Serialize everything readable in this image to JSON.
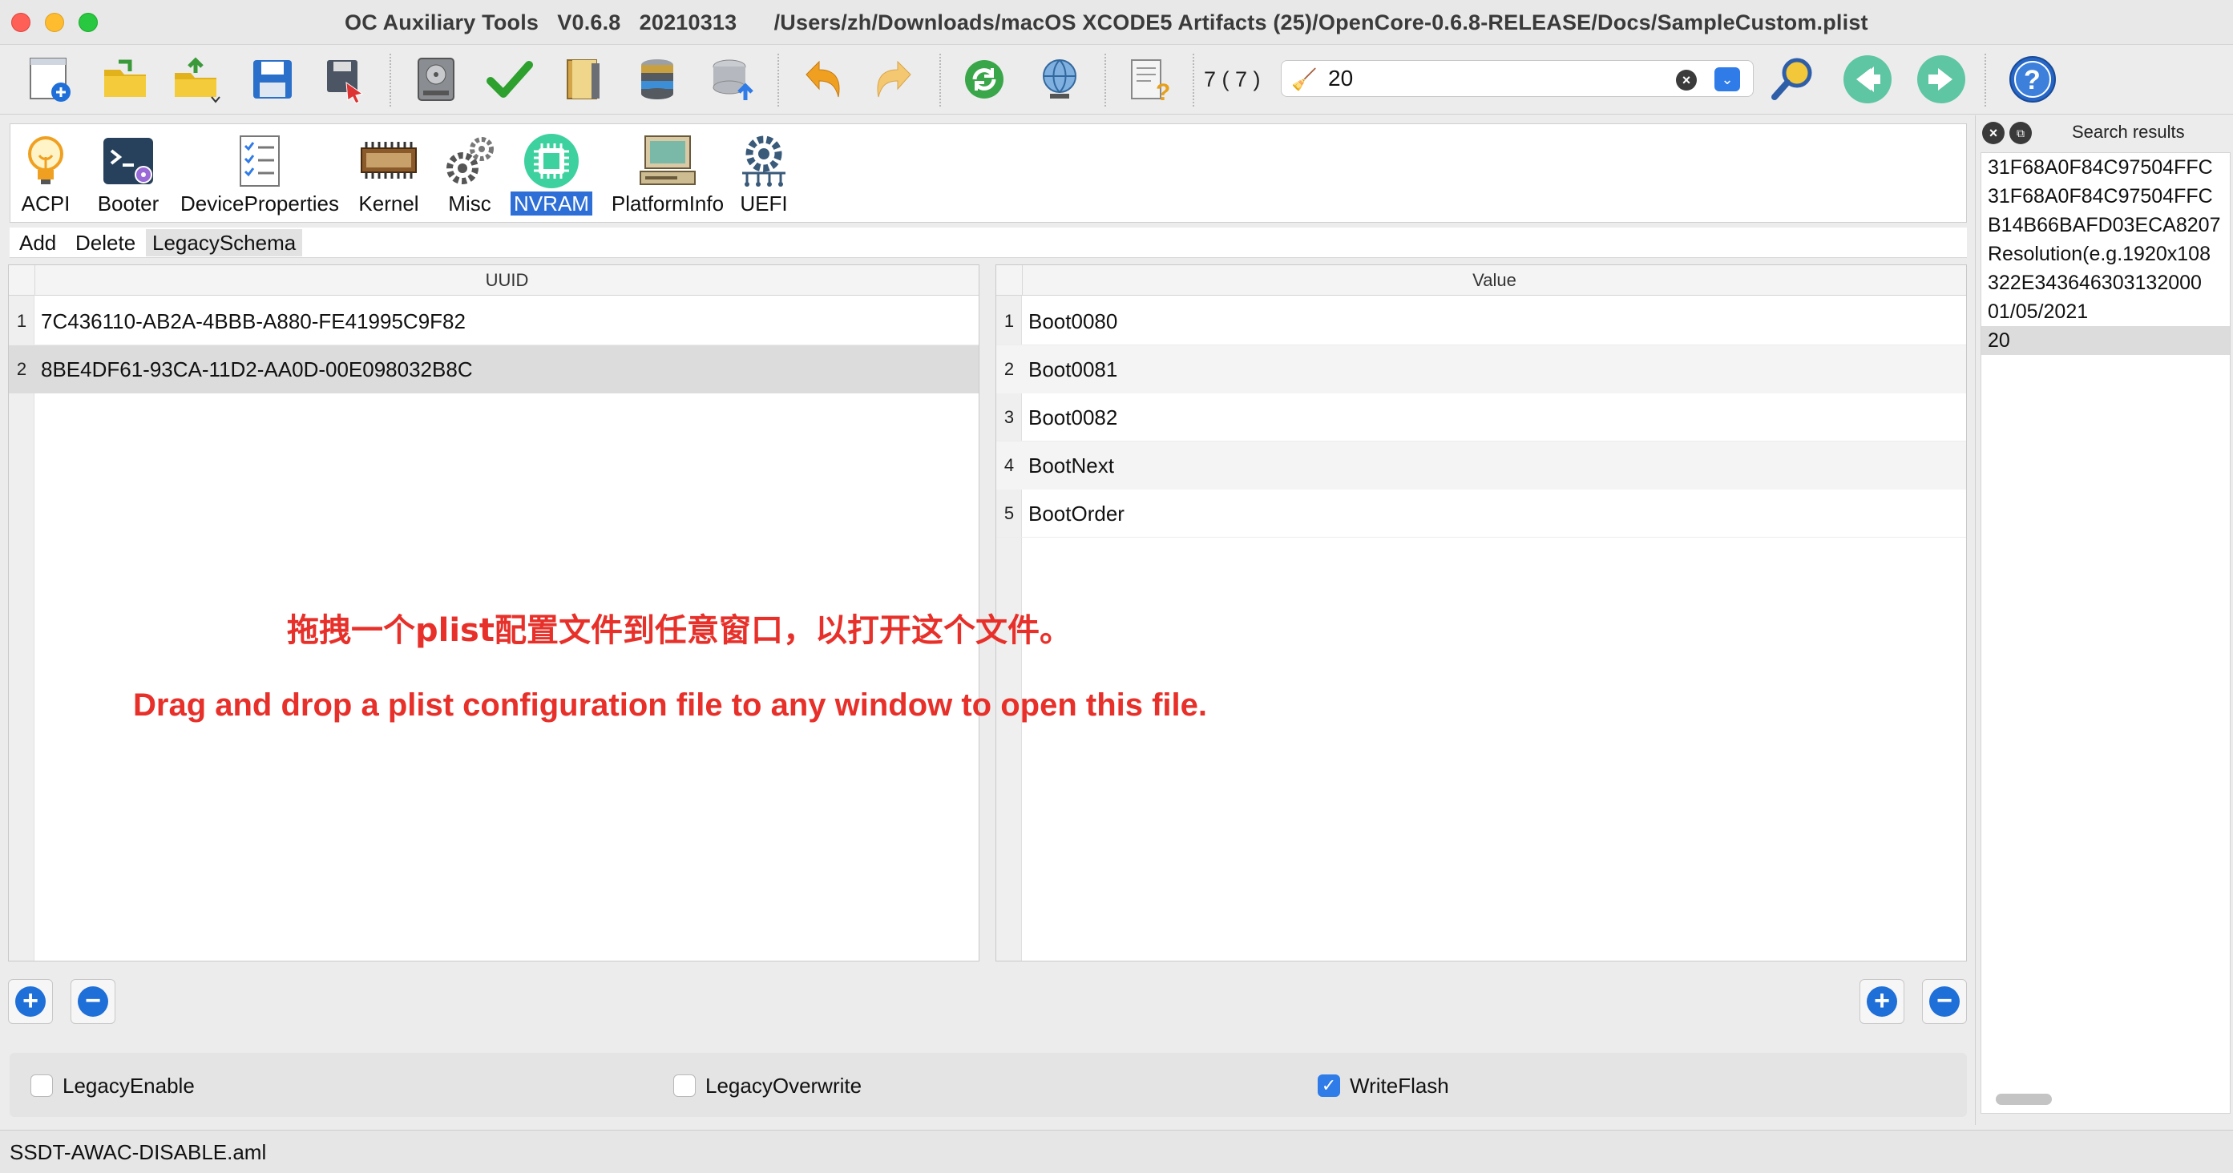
{
  "window": {
    "app_name": "OC Auxiliary Tools",
    "version": "V0.6.8",
    "build": "20210313",
    "file_path": "/Users/zh/Downloads/macOS XCODE5 Artifacts (25)/OpenCore-0.6.8-RELEASE/Docs/SampleCustom.plist"
  },
  "toolbar": {
    "buttons": [
      {
        "name": "new-file",
        "icon": "new-document-icon"
      },
      {
        "name": "open-folder",
        "icon": "folder-icon"
      },
      {
        "name": "open-recent",
        "icon": "folder-arrow-icon"
      },
      {
        "name": "save",
        "icon": "floppy-disk-icon"
      },
      {
        "name": "save-as",
        "icon": "save-as-icon"
      },
      {
        "name": "mount-efi",
        "icon": "hard-disk-icon"
      },
      {
        "name": "verify",
        "icon": "checkmark-icon"
      },
      {
        "name": "open-database",
        "icon": "book-icon"
      },
      {
        "name": "database",
        "icon": "database-icon"
      },
      {
        "name": "upgrade",
        "icon": "database-upload-icon"
      },
      {
        "name": "undo",
        "icon": "undo-arrow-icon"
      },
      {
        "name": "redo",
        "icon": "redo-arrow-icon"
      },
      {
        "name": "refresh",
        "icon": "refresh-icon"
      },
      {
        "name": "network",
        "icon": "globe-icon"
      },
      {
        "name": "help-doc",
        "icon": "document-question-icon"
      }
    ],
    "match_count": "7 ( 7 )",
    "search_value": "20",
    "help_icon": "help-icon"
  },
  "categories": [
    {
      "label": "ACPI",
      "icon": "lightbulb-icon"
    },
    {
      "label": "Booter",
      "icon": "terminal-gear-icon"
    },
    {
      "label": "DeviceProperties",
      "icon": "checklist-icon"
    },
    {
      "label": "Kernel",
      "icon": "chip-icon"
    },
    {
      "label": "Misc",
      "icon": "gears-icon"
    },
    {
      "label": "NVRAM",
      "icon": "nvram-chip-icon"
    },
    {
      "label": "PlatformInfo",
      "icon": "computer-icon"
    },
    {
      "label": "UEFI",
      "icon": "uefi-gear-icon"
    }
  ],
  "active_category": "NVRAM",
  "subtabs": [
    "Add",
    "Delete",
    "LegacySchema"
  ],
  "active_subtab": "LegacySchema",
  "left_table": {
    "header": "UUID",
    "rows": [
      {
        "num": "1",
        "value": "7C436110-AB2A-4BBB-A880-FE41995C9F82"
      },
      {
        "num": "2",
        "value": "8BE4DF61-93CA-11D2-AA0D-00E098032B8C"
      }
    ]
  },
  "right_table": {
    "header": "Value",
    "rows": [
      {
        "num": "1",
        "value": "Boot0080"
      },
      {
        "num": "2",
        "value": "Boot0081"
      },
      {
        "num": "3",
        "value": "Boot0082"
      },
      {
        "num": "4",
        "value": "BootNext"
      },
      {
        "num": "5",
        "value": "BootOrder"
      }
    ]
  },
  "overlay": {
    "zh": "拖拽一个plist配置文件到任意窗口，以打开这个文件。",
    "en": "Drag and drop a plist configuration file to any window to open this file."
  },
  "checkboxes": [
    {
      "label": "LegacyEnable",
      "checked": false
    },
    {
      "label": "LegacyOverwrite",
      "checked": false
    },
    {
      "label": "WriteFlash",
      "checked": true
    }
  ],
  "search_results": {
    "title": "Search results",
    "items": [
      "31F68A0F84C97504FFC",
      "31F68A0F84C97504FFC",
      "B14B66BAFD03ECA8207",
      "Resolution(e.g.1920x108",
      "322E343646303132000",
      "01/05/2021",
      "20"
    ],
    "selected_index": 6
  },
  "status": {
    "text": "SSDT-AWAC-DISABLE.aml"
  },
  "colors": {
    "accent": "#2f7be8",
    "active_tab": "#2d6fd6",
    "overlay_text": "#e8302a"
  }
}
